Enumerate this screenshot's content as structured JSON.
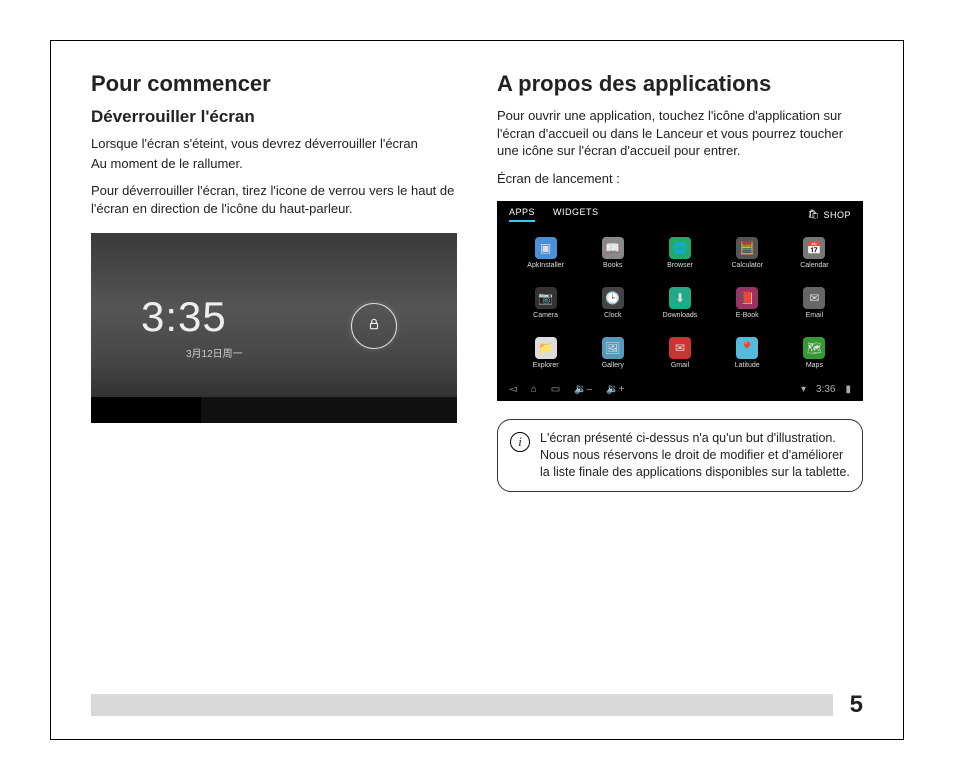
{
  "left": {
    "heading": "Pour commencer",
    "subheading": "Déverrouiller l'écran",
    "para1": "Lorsque l'écran s'éteint, vous devrez déverrouiller l'écran",
    "para2": "Au moment de le rallumer.",
    "para3": "Pour déverrouiller l'écran, tirez l'icone de verrou vers le haut de l'écran en direction de l'icône du haut-parleur.",
    "lock_time": "3:35",
    "lock_date": "3月12日周一"
  },
  "right": {
    "heading": "A propos des applications",
    "para1": "Pour ouvrir une application, touchez l'icône d'application sur l'écran d'accueil ou dans le Lanceur et vous pourrez toucher une icône sur l'écran d'accueil pour entrer.",
    "label_launch": "Écran de lancement :",
    "launcher": {
      "tab_apps": "APPS",
      "tab_widgets": "WIDGETS",
      "shop": "SHOP",
      "apps": [
        {
          "label": "ApkInstaller",
          "bg": "#4a90d9",
          "glyph": "▣"
        },
        {
          "label": "Books",
          "bg": "#888",
          "glyph": "📖"
        },
        {
          "label": "Browser",
          "bg": "#2a6",
          "glyph": "🌐"
        },
        {
          "label": "Calculator",
          "bg": "#555",
          "glyph": "🧮"
        },
        {
          "label": "Calendar",
          "bg": "#777",
          "glyph": "📅"
        },
        {
          "label": "Camera",
          "bg": "#333",
          "glyph": "📷"
        },
        {
          "label": "Clock",
          "bg": "#444",
          "glyph": "🕒"
        },
        {
          "label": "Downloads",
          "bg": "#2a8",
          "glyph": "⬇"
        },
        {
          "label": "E-Book",
          "bg": "#936",
          "glyph": "📕"
        },
        {
          "label": "Email",
          "bg": "#666",
          "glyph": "✉"
        },
        {
          "label": "Explorer",
          "bg": "#ddd",
          "glyph": "📁"
        },
        {
          "label": "Gallery",
          "bg": "#59b",
          "glyph": "🖼"
        },
        {
          "label": "Gmail",
          "bg": "#c33",
          "glyph": "✉"
        },
        {
          "label": "Latitude",
          "bg": "#5bd",
          "glyph": "📍"
        },
        {
          "label": "Maps",
          "bg": "#393",
          "glyph": "🗺"
        }
      ],
      "status_time": "3:36"
    },
    "note": "L'écran présenté ci-dessus n'a qu'un but d'illustration. Nous nous réservons le droit de modifier et d'améliorer la liste finale des applications disponibles sur la tablette."
  },
  "page_number": "5"
}
